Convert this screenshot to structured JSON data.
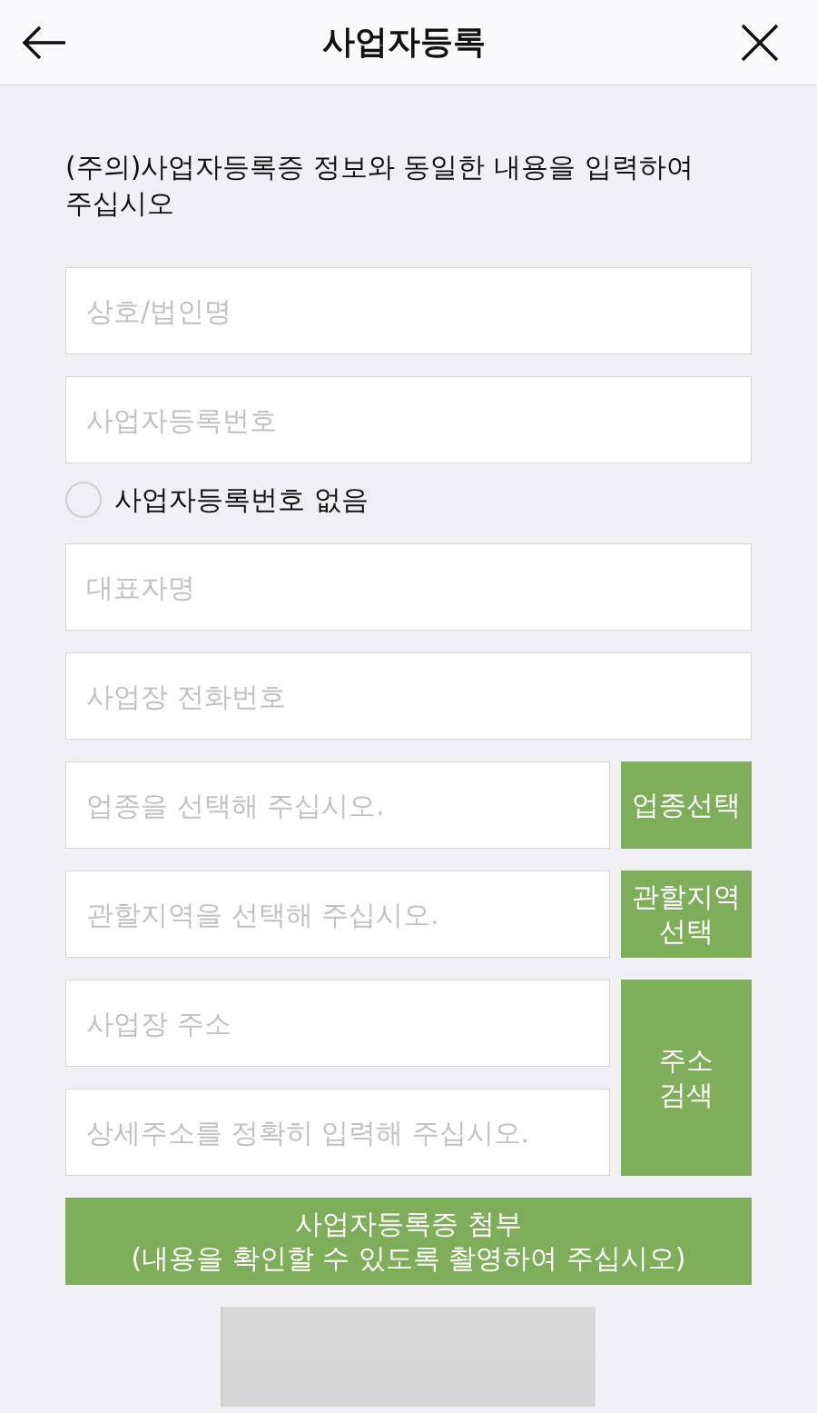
{
  "header": {
    "title": "사업자등록"
  },
  "notice": "(주의)사업자등록증 정보와 동일한 내용을 입력하여 주십시오",
  "form": [
    {
      "kind": "field",
      "placeholder": "상호/법인명"
    },
    {
      "kind": "field",
      "placeholder": "사업자등록번호"
    },
    {
      "kind": "radio",
      "label": "사업자등록번호 없음",
      "checked": false
    },
    {
      "kind": "field",
      "placeholder": "대표자명"
    },
    {
      "kind": "field",
      "placeholder": "사업장 전화번호"
    },
    {
      "kind": "field_button",
      "placeholders": [
        "업종을 선택해 주십시오."
      ],
      "button": "업종선택"
    },
    {
      "kind": "field_button",
      "placeholders": [
        "관할지역을 선택해 주십시오."
      ],
      "button": "관할지역\n선택"
    },
    {
      "kind": "field_button",
      "placeholders": [
        "사업장 주소",
        "상세주소를 정확히 입력해 주십시오."
      ],
      "button": "주소\n검색"
    }
  ],
  "attach_button": "사업자등록증 첨부\n(내용을 확인할 수 있도록 촬영하여 주십시오)"
}
